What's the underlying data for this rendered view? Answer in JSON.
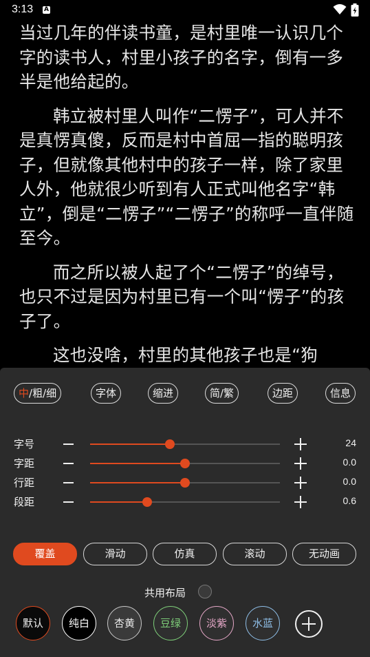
{
  "status_bar": {
    "time": "3:13",
    "notification_letter": "A"
  },
  "reader": {
    "paragraphs": [
      "当过几年的伴读书童，是村里唯一认识几个字的读书人，村里小孩子的名字，倒有一多半是他给起的。",
      "韩立被村里人叫作“二愣子”，可人并不是真愣真傻，反而是村中首屈一指的聪明孩子，但就像其他村中的孩子一样，除了家里人外，他就很少听到有人正式叫他名字“韩立”，倒是“二愣子”“二愣子”的称呼一直伴随至今。",
      "而之所以被人起了个“二愣子”的绰号，也只不过是因为村里已有一个叫“愣子”的孩子了。",
      "这也没啥，村里的其他孩子也是“狗娃”“二蛋”之类的被人一直称呼着，这些名"
    ]
  },
  "settings": {
    "top_buttons": {
      "weight": {
        "accent": "中",
        "rest": "/粗/细"
      },
      "font": "字体",
      "indent": "缩进",
      "convert": "简/繁",
      "margin": "边距",
      "info": "信息"
    },
    "sliders": [
      {
        "label": "字号",
        "value": "24",
        "fraction": 0.42
      },
      {
        "label": "字距",
        "value": "0.0",
        "fraction": 0.5
      },
      {
        "label": "行距",
        "value": "0.0",
        "fraction": 0.5
      },
      {
        "label": "段距",
        "value": "0.6",
        "fraction": 0.3
      }
    ],
    "page_animations": [
      "覆盖",
      "滑动",
      "仿真",
      "滚动",
      "无动画"
    ],
    "active_animation": "覆盖",
    "shared_layout_label": "共用布局",
    "themes": [
      {
        "label": "默认",
        "bg": "#0a0a0a",
        "fg": "#f0f0f0",
        "border": "#e04a1f"
      },
      {
        "label": "纯白",
        "bg": "#000000",
        "fg": "#ffffff",
        "border": "#ffffff"
      },
      {
        "label": "杏黄",
        "bg": "#3a3a3a",
        "fg": "#e8e8e8",
        "border": "#c9c9c9"
      },
      {
        "label": "豆绿",
        "bg": "#2f2f2f",
        "fg": "#7fd07a",
        "border": "#7fd07a"
      },
      {
        "label": "淡紫",
        "bg": "#2f2f2f",
        "fg": "#e6a8c8",
        "border": "#e6a8c8"
      },
      {
        "label": "水蓝",
        "bg": "#2f2f2f",
        "fg": "#8fbfe8",
        "border": "#8fbfe8"
      }
    ],
    "colors": {
      "accent": "#e04a1f",
      "panel_bg": "#2b2b2b"
    }
  }
}
